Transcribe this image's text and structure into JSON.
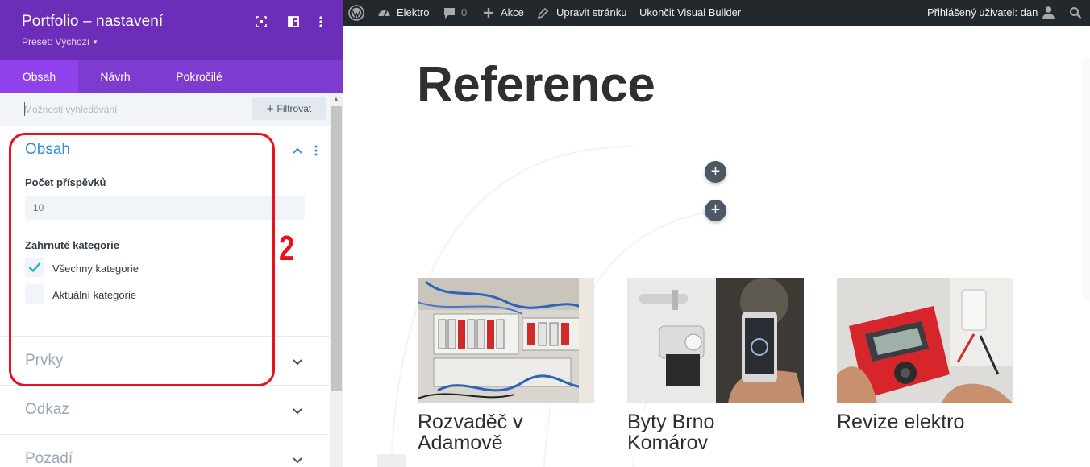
{
  "panel": {
    "title": "Portfolio – nastavení",
    "preset": "Preset: Výchozí",
    "icons": [
      "target-icon",
      "columns-icon",
      "more-vertical-icon"
    ],
    "tabs": [
      {
        "label": "Obsah",
        "active": true
      },
      {
        "label": "Návrh",
        "active": false
      },
      {
        "label": "Pokročilé",
        "active": false
      }
    ],
    "search_placeholder": "Možnosti vyhledávání",
    "filter_label": "Filtrovat",
    "sections": {
      "content": {
        "title": "Obsah",
        "post_count_label": "Počet příspěvků",
        "post_count_value": "10",
        "categories_label": "Zahrnuté kategorie",
        "categories": [
          {
            "label": "Všechny kategorie",
            "checked": true
          },
          {
            "label": "Aktuální kategorie",
            "checked": false
          }
        ]
      },
      "collapsed": [
        "Prvky",
        "Odkaz",
        "Pozadí"
      ]
    },
    "annotation_number": "2"
  },
  "adminbar": {
    "site": "Elektro",
    "comments": "0",
    "new": "Akce",
    "edit": "Upravit stránku",
    "exit": "Ukončit Visual Builder",
    "user": "Přihlášený uživatel: dan"
  },
  "page": {
    "title": "Reference",
    "items": [
      {
        "title": "Rozvaděč v Adamově",
        "image": "electrical-panel-image"
      },
      {
        "title": "Byty Brno Komárov",
        "image": "smart-lock-phone-image"
      },
      {
        "title": "Revize elektro",
        "image": "multimeter-image"
      }
    ]
  },
  "colors": {
    "panel_header": "#6c2eb9",
    "tabs_bar": "#7e3bd0",
    "active_tab": "#8f42ec",
    "open_section": "#2e90d8",
    "annotation": "#e8121f",
    "adminbar": "#23282d"
  }
}
